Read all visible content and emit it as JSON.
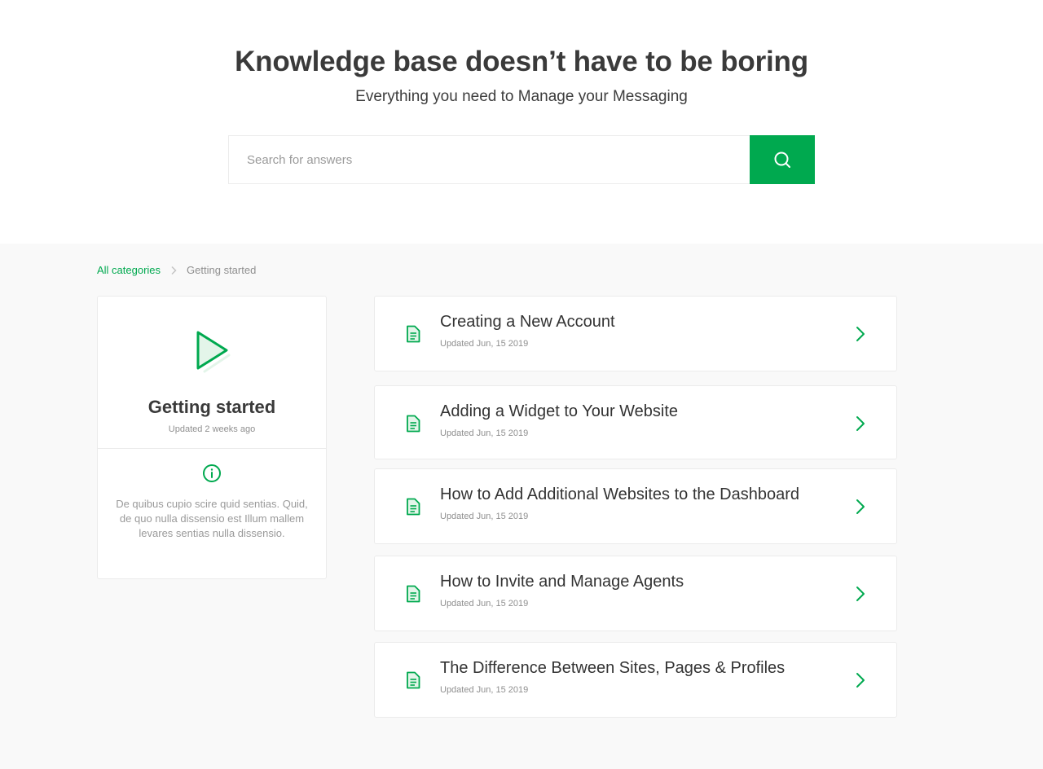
{
  "hero": {
    "title": "Knowledge base doesn’t have to be boring",
    "subtitle": "Everything you need to Manage your Messaging"
  },
  "search": {
    "placeholder": "Search for answers",
    "value": "",
    "button_icon": "search-icon"
  },
  "breadcrumb": {
    "parent": "All categories",
    "separator_icon": "chevron-right-icon",
    "current": "Getting started"
  },
  "category": {
    "icon": "play-icon",
    "title": "Getting started",
    "updated": "Updated 2 weeks ago",
    "info_icon": "info-icon",
    "description": "De quibus cupio scire quid sentias. Quid, de quo nulla dissensio est Illum mallem levares sentias nulla dissensio."
  },
  "articles": [
    {
      "title": "Creating a New Account",
      "updated": "Updated Jun, 15 2019"
    },
    {
      "title": "Adding a Widget to Your Website",
      "updated": "Updated Jun, 15 2019"
    },
    {
      "title": "How to Add Additional Websites to the Dashboard",
      "updated": "Updated Jun, 15 2019"
    },
    {
      "title": "How to Invite and Manage Agents",
      "updated": "Updated Jun, 15 2019"
    },
    {
      "title": "The Difference Between Sites, Pages & Profiles",
      "updated": "Updated Jun, 15 2019"
    }
  ],
  "colors": {
    "accent": "#00a94f",
    "background": "#f9f9f9"
  }
}
